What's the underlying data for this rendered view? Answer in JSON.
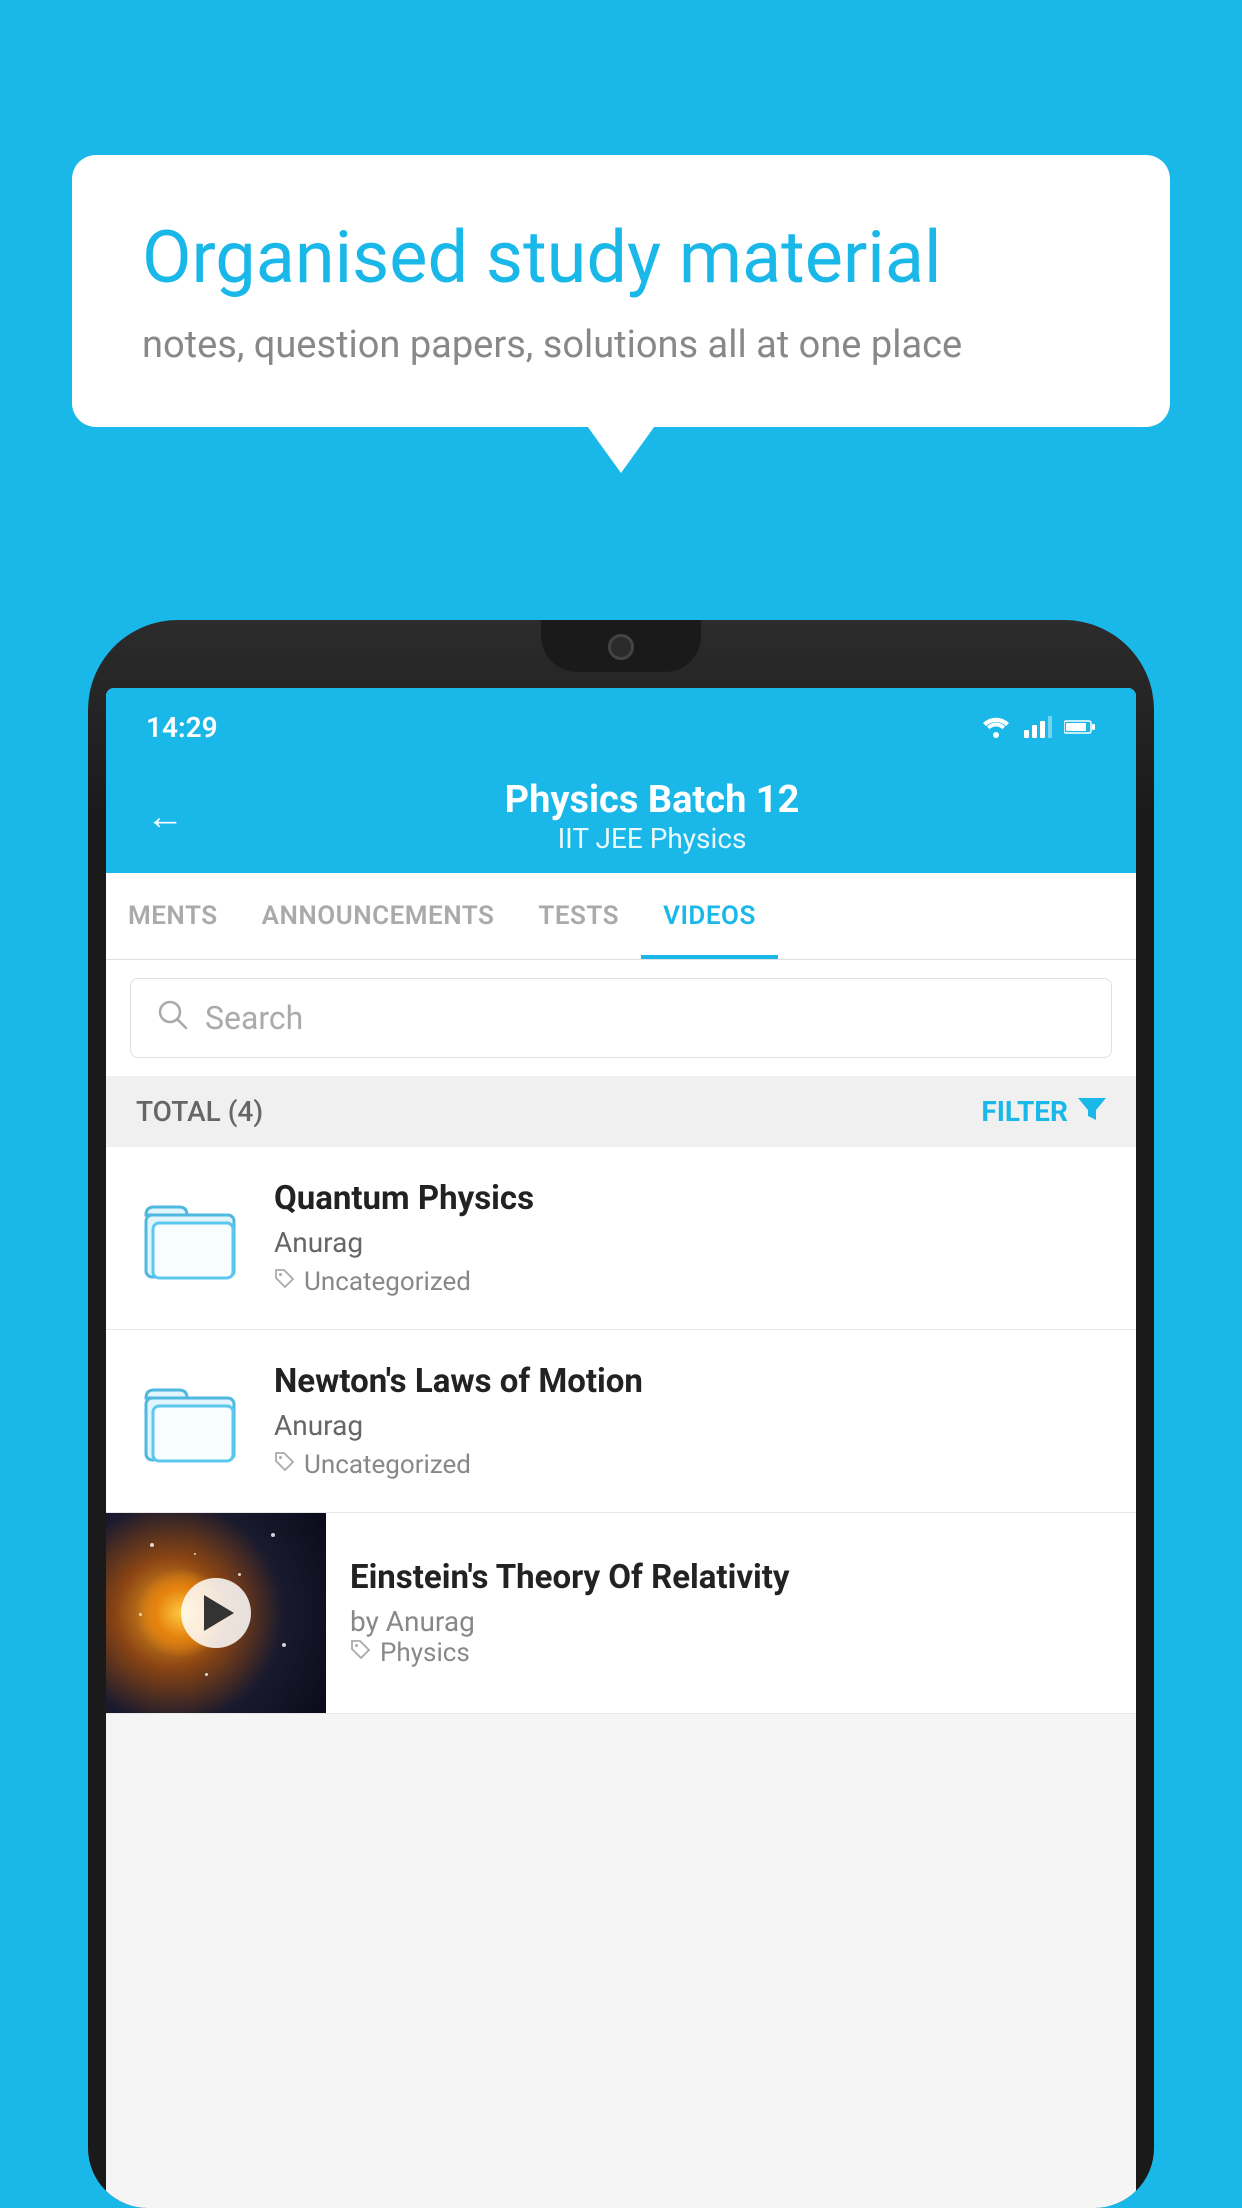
{
  "background_color": "#1ab8e8",
  "bubble": {
    "title": "Organised study material",
    "subtitle": "notes, question papers, solutions all at one place"
  },
  "status_bar": {
    "time": "14:29",
    "icons": [
      "wifi",
      "signal",
      "battery"
    ]
  },
  "header": {
    "title": "Physics Batch 12",
    "subtitle": "IIT JEE   Physics",
    "back_label": "←"
  },
  "tabs": [
    {
      "label": "MENTS",
      "active": false
    },
    {
      "label": "ANNOUNCEMENTS",
      "active": false
    },
    {
      "label": "TESTS",
      "active": false
    },
    {
      "label": "VIDEOS",
      "active": true
    }
  ],
  "search": {
    "placeholder": "Search"
  },
  "filter_bar": {
    "total_label": "TOTAL (4)",
    "filter_label": "FILTER"
  },
  "videos": [
    {
      "title": "Quantum Physics",
      "author": "Anurag",
      "tag": "Uncategorized",
      "has_thumbnail": false
    },
    {
      "title": "Newton's Laws of Motion",
      "author": "Anurag",
      "tag": "Uncategorized",
      "has_thumbnail": false
    },
    {
      "title": "Einstein's Theory Of Relativity",
      "author": "by Anurag",
      "tag": "Physics",
      "has_thumbnail": true
    }
  ]
}
